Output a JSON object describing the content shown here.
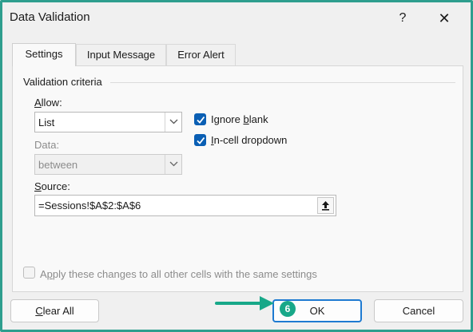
{
  "window": {
    "title": "Data Validation",
    "help_label": "?",
    "close_label": "✕"
  },
  "tabs": [
    {
      "label": "Settings",
      "active": true
    },
    {
      "label": "Input Message",
      "active": false
    },
    {
      "label": "Error Alert",
      "active": false
    }
  ],
  "settings": {
    "group_label": "Validation criteria",
    "allow": {
      "label_accel": "A",
      "label_rest": "llow:",
      "value": "List"
    },
    "data": {
      "label": "Data:",
      "value": "between",
      "disabled": true
    },
    "source": {
      "label_accel": "S",
      "label_rest": "ource:",
      "value": "=Sessions!$A$2:$A$6"
    },
    "ignore_blank": {
      "label_pre": "Ignore ",
      "label_accel": "b",
      "label_post": "lank",
      "checked": true
    },
    "in_cell_dropdown": {
      "label_accel": "I",
      "label_rest": "n-cell dropdown",
      "checked": true
    },
    "apply_all": {
      "label_pre": "A",
      "label_accel": "p",
      "label_post": "ply these changes to all other cells with the same settings",
      "checked": false,
      "disabled": true
    }
  },
  "buttons": {
    "clear_all_accel": "C",
    "clear_all_rest": "lear All",
    "ok": "OK",
    "cancel": "Cancel"
  },
  "annotation": {
    "step_number": "6",
    "color": "#18a889"
  },
  "colors": {
    "accent": "#0a5fb4",
    "frame": "#2e9e8e",
    "ok_border": "#1e7ad1"
  }
}
